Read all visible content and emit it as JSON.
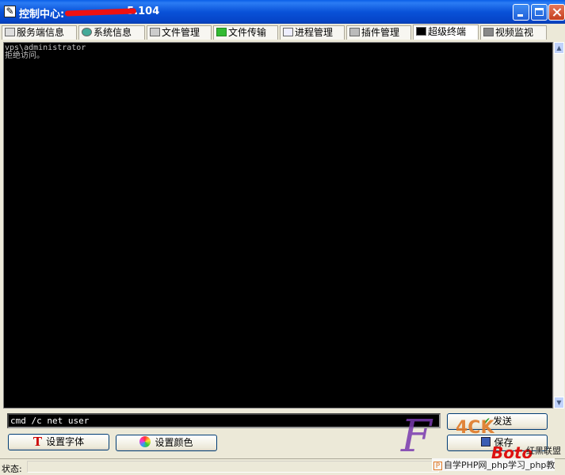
{
  "window": {
    "title": "控制中心:",
    "title_ip_fragment": "5.104",
    "icon": "app-pen-icon"
  },
  "tabs": [
    {
      "label": "服务端信息",
      "icon": "server-icon"
    },
    {
      "label": "系统信息",
      "icon": "globe-icon"
    },
    {
      "label": "文件管理",
      "icon": "file-icon"
    },
    {
      "label": "文件传输",
      "icon": "transfer-icon"
    },
    {
      "label": "进程管理",
      "icon": "process-icon"
    },
    {
      "label": "插件管理",
      "icon": "plugin-icon"
    },
    {
      "label": "超级终端",
      "icon": "terminal-icon",
      "active": true
    },
    {
      "label": "视频监视",
      "icon": "camera-icon"
    }
  ],
  "terminal": {
    "lines": [
      "vps\\administrator",
      "拒绝访问。"
    ],
    "background": "#000000",
    "text_color": "#c0c0c0"
  },
  "command": {
    "value": "cmd /c net user"
  },
  "buttons": {
    "send": "发送",
    "save": "保存",
    "set_font": "设置字体",
    "set_color": "设置颜色"
  },
  "status": {
    "label": "状态:"
  },
  "watermark": {
    "brand": "F",
    "number": "4CK",
    "red_text": "Boto",
    "alliance": "红黑联盟",
    "site_text": "自学PHP网_php学习_php教"
  }
}
